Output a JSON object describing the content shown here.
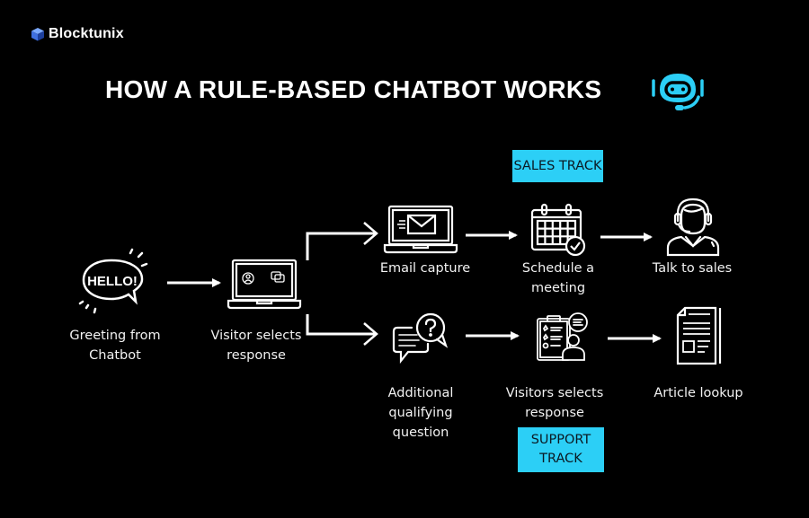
{
  "brand": {
    "name": "Blocktunix",
    "icon": "cube-icon",
    "accent": "#2ccff6"
  },
  "title": {
    "text": "HOW A RULE-BASED CHATBOT WORKS",
    "icon": "chatbot-headset-icon"
  },
  "tracks": {
    "sales": {
      "label": "SALES TRACK"
    },
    "support": {
      "label_line1": "SUPPORT",
      "label_line2": "TRACK"
    }
  },
  "steps": {
    "greeting": {
      "line1": "Greeting from",
      "line2": "Chatbot",
      "icon": "hello-speech-bubble-icon",
      "bubble_text": "HELLO!"
    },
    "visitor_select": {
      "line1": "Visitor selects",
      "line2": "response",
      "icon": "laptop-options-icon"
    },
    "email_capture": {
      "line1": "Email capture",
      "icon": "laptop-email-icon"
    },
    "schedule_meeting": {
      "line1": "Schedule a",
      "line2": "meeting",
      "icon": "calendar-check-icon"
    },
    "talk_sales": {
      "line1": "Talk to sales",
      "icon": "sales-agent-headset-icon"
    },
    "qualifying_question": {
      "line1": "Additional",
      "line2": "qualifying",
      "line3": "question",
      "icon": "question-chat-icon"
    },
    "visitors_select": {
      "line1": "Visitors selects",
      "line2": "response",
      "icon": "survey-person-icon"
    },
    "article_lookup": {
      "line1": "Article lookup",
      "icon": "document-article-icon"
    }
  },
  "colors": {
    "background": "#000000",
    "foreground": "#ffffff",
    "tag_bg": "#2ccff6",
    "tag_text": "#0b1a24"
  }
}
